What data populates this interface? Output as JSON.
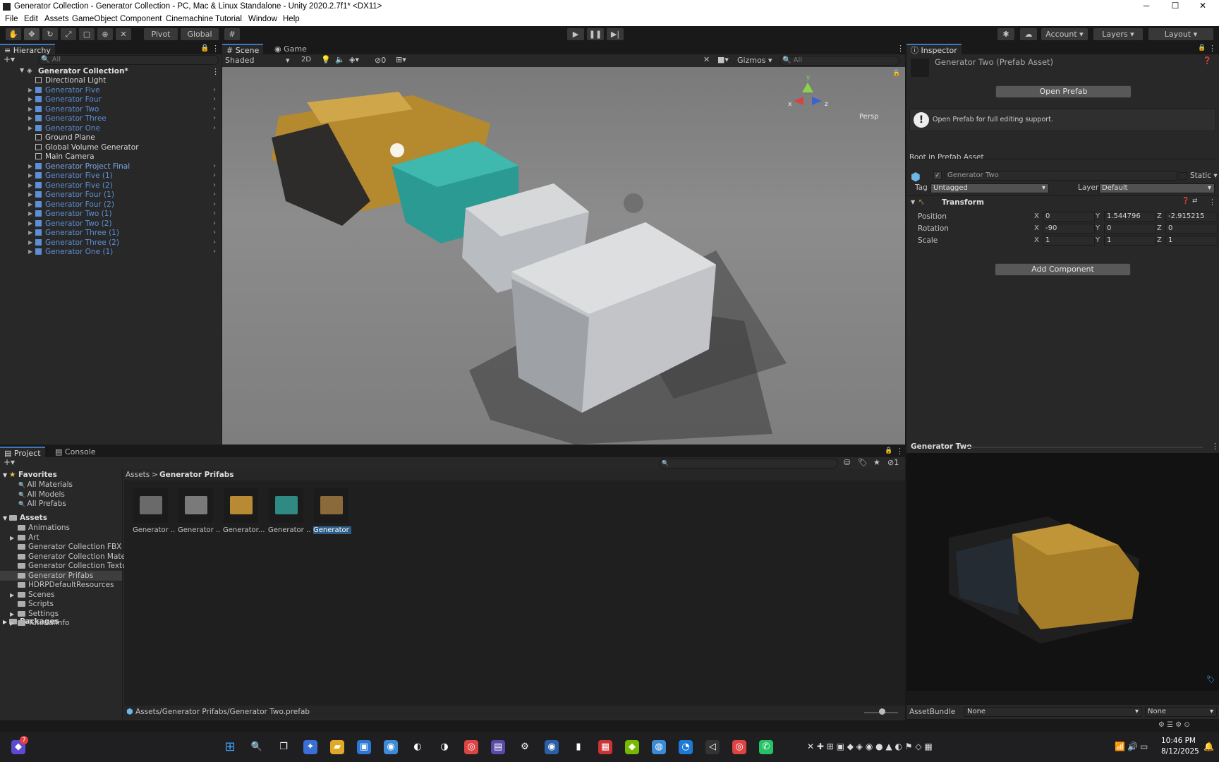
{
  "window": {
    "title": "Generator Collection - Generator Collection - PC, Mac & Linux Standalone - Unity 2020.2.7f1* <DX11>",
    "min": "─",
    "max": "☐",
    "close": "✕"
  },
  "menu": [
    "File",
    "Edit",
    "Assets",
    "GameObject",
    "Component",
    "Cinemachine",
    "Tutorial",
    "Window",
    "Help"
  ],
  "toolbar": {
    "pivot": "Pivot",
    "global": "Global",
    "account": "Account",
    "layers": "Layers",
    "layout": "Layout"
  },
  "hierarchy": {
    "tab": "Hierarchy",
    "search": "All",
    "root": "Generator Collection*",
    "items": [
      {
        "label": "Directional Light",
        "style": "white",
        "arrow": false
      },
      {
        "label": "Generator Five",
        "style": "blue",
        "arrow": true
      },
      {
        "label": "Generator Four",
        "style": "blue",
        "arrow": true
      },
      {
        "label": "Generator Two",
        "style": "blue",
        "arrow": true
      },
      {
        "label": "Generator Three",
        "style": "blue",
        "arrow": true
      },
      {
        "label": "Generator One",
        "style": "blue",
        "arrow": true
      },
      {
        "label": "Ground Plane",
        "style": "white",
        "arrow": false
      },
      {
        "label": "Global Volume Generator",
        "style": "white",
        "arrow": false
      },
      {
        "label": "Main Camera",
        "style": "white",
        "arrow": false
      },
      {
        "label": "Generator Project Final",
        "style": "blue2",
        "arrow": true
      },
      {
        "label": "Generator Five (1)",
        "style": "blue",
        "arrow": true
      },
      {
        "label": "Generator Five (2)",
        "style": "blue",
        "arrow": true
      },
      {
        "label": "Generator Four (1)",
        "style": "blue",
        "arrow": true
      },
      {
        "label": "Generator Four (2)",
        "style": "blue",
        "arrow": true
      },
      {
        "label": "Generator Two (1)",
        "style": "blue",
        "arrow": true
      },
      {
        "label": "Generator Two (2)",
        "style": "blue",
        "arrow": true
      },
      {
        "label": "Generator Three (1)",
        "style": "blue",
        "arrow": true
      },
      {
        "label": "Generator Three (2)",
        "style": "blue",
        "arrow": true
      },
      {
        "label": "Generator One (1)",
        "style": "blue",
        "arrow": true
      }
    ]
  },
  "scene": {
    "tab_scene": "Scene",
    "tab_game": "Game",
    "shading": "Shaded",
    "mode2d": "2D",
    "hidden_count": "0",
    "gizmos": "Gizmos",
    "search": "All",
    "persp": "Persp",
    "axis_y": "y",
    "axis_x": "x",
    "axis_z": "z"
  },
  "inspector": {
    "tab": "Inspector",
    "asset_title": "Generator Two (Prefab Asset)",
    "open_prefab": "Open Prefab",
    "info": "Open Prefab for full editing support.",
    "root_label": "Root in Prefab Asset",
    "object_name": "Generator Two",
    "static": "Static",
    "tag_label": "Tag",
    "tag_value": "Untagged",
    "layer_label": "Layer",
    "layer_value": "Default",
    "transform": "Transform",
    "rows": [
      {
        "label": "Position",
        "x": "0",
        "y": "1.544796",
        "z": "-2.915215"
      },
      {
        "label": "Rotation",
        "x": "-90",
        "y": "0",
        "z": "0"
      },
      {
        "label": "Scale",
        "x": "1",
        "y": "1",
        "z": "1"
      }
    ],
    "add_component": "Add Component",
    "preview_title": "Generator Two",
    "assetbundle_label": "AssetBundle",
    "assetbundle_value": "None",
    "assetbundle_variant": "None"
  },
  "project": {
    "tab_project": "Project",
    "tab_console": "Console",
    "favorites": "Favorites",
    "fav_items": [
      "All Materials",
      "All Models",
      "All Prefabs"
    ],
    "assets": "Assets",
    "folders": [
      {
        "label": "Animations",
        "arrow": false
      },
      {
        "label": "Art",
        "arrow": true
      },
      {
        "label": "Generator Collection FBX",
        "arrow": false
      },
      {
        "label": "Generator Collection Materi",
        "arrow": false
      },
      {
        "label": "Generator Collection Textur",
        "arrow": false
      },
      {
        "label": "Generator Prifabs",
        "arrow": false,
        "selected": true
      },
      {
        "label": "HDRPDefaultResources",
        "arrow": false
      },
      {
        "label": "Scenes",
        "arrow": true
      },
      {
        "label": "Scripts",
        "arrow": false
      },
      {
        "label": "Settings",
        "arrow": true
      },
      {
        "label": "TutorialInfo",
        "arrow": true
      }
    ],
    "packages": "Packages",
    "breadcrumb_root": "Assets",
    "breadcrumb_sep": ">",
    "breadcrumb_current": "Generator Prifabs",
    "thumbs": [
      {
        "label": "Generator ...",
        "color": "#6a6a6a"
      },
      {
        "label": "Generator ...",
        "color": "#7a7a7a"
      },
      {
        "label": "Generator...",
        "color": "#b88a33"
      },
      {
        "label": "Generator ...",
        "color": "#2f8a84"
      },
      {
        "label": "Generator ...",
        "color": "#8a6a3a",
        "selected": true
      }
    ],
    "status_path": "Assets/Generator Prifabs/Generator Two.prefab",
    "badge_count": "1"
  },
  "taskbar": {
    "notif": "7",
    "time": "10:46 PM",
    "date": "8/12/2025"
  },
  "colors": {
    "accent": "#3a79bb",
    "selection": "#2c5d87"
  }
}
